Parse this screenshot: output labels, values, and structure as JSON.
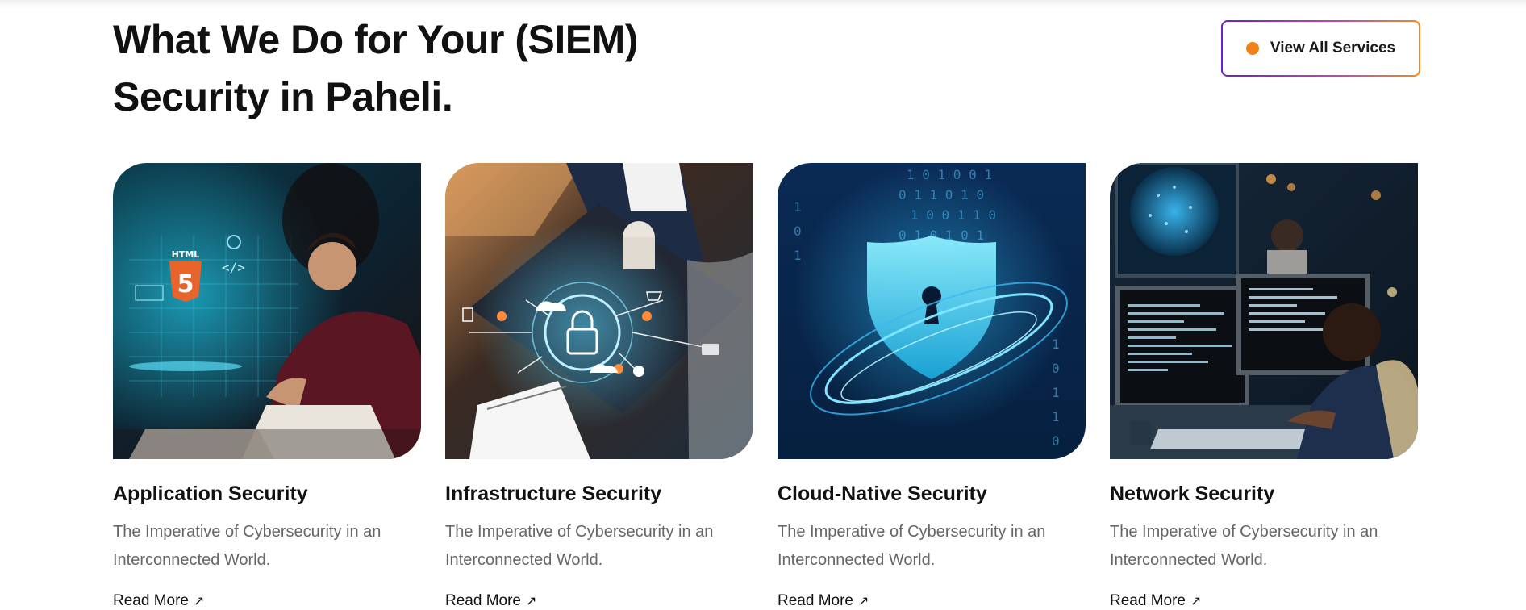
{
  "section": {
    "title_line1": "What We Do for Your (SIEM)",
    "title_line2": "Security in Paheli."
  },
  "view_all_button": {
    "label": "View All Services"
  },
  "colors": {
    "accent_orange": "#f0821a",
    "gradient_start": "#6a1fd1",
    "gradient_end": "#f28a1c"
  },
  "cards": [
    {
      "title": "Application Security",
      "description": "The Imperative of Cybersecurity in an Interconnected World.",
      "read_more": "Read More",
      "image": "application-security-image",
      "image_text": "HTML"
    },
    {
      "title": "Infrastructure Security",
      "description": "The Imperative of Cybersecurity in an Interconnected World.",
      "read_more": "Read More",
      "image": "infrastructure-security-image"
    },
    {
      "title": "Cloud-Native Security",
      "description": "The Imperative of Cybersecurity in an Interconnected World.",
      "read_more": "Read More",
      "image": "cloud-native-security-image"
    },
    {
      "title": "Network Security",
      "description": "The Imperative of Cybersecurity in an Interconnected World.",
      "read_more": "Read More",
      "image": "network-security-image"
    }
  ],
  "icons": {
    "read_more_arrow": "arrow-up-right-icon",
    "button_dot": "orange-dot-icon"
  }
}
